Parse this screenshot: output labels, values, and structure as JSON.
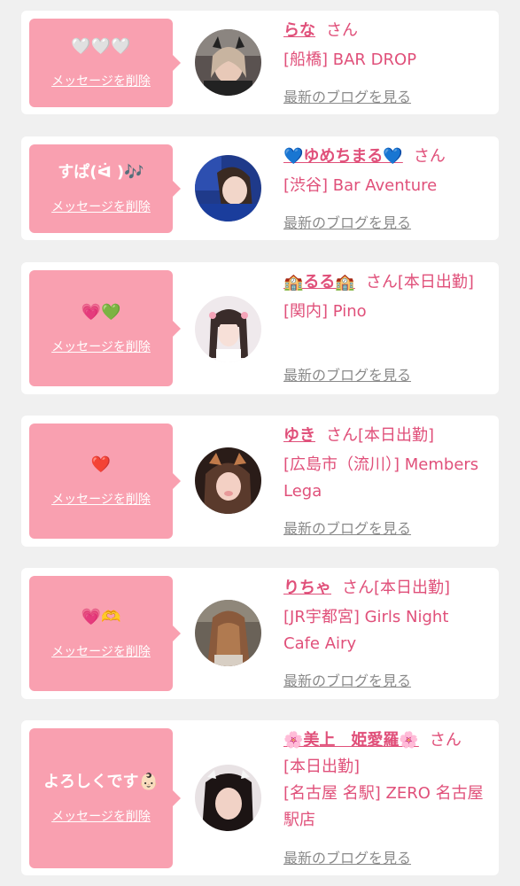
{
  "common": {
    "delete_label": "メッセージを削除",
    "blog_label": "最新のブログを見る"
  },
  "entries": [
    {
      "message": "🤍🤍🤍",
      "name": "らな",
      "san": "さん",
      "shop": "[船橋] BAR DROP",
      "avatar_icon": "profile-photo"
    },
    {
      "message": "すぱ(ᐛ )🎶",
      "name": "💙ゆめちまる💙",
      "san": "さん",
      "shop": "[渋谷] Bar Aventure",
      "avatar_icon": "profile-photo"
    },
    {
      "message": "💗💚",
      "name": "🏫るる🏫",
      "san": "さん[本日出勤]",
      "shop": "[関内] Pino",
      "avatar_icon": "profile-photo"
    },
    {
      "message": "❤️",
      "name": "ゆき",
      "san": "さん[本日出勤]",
      "shop": "[広島市（流川）] Members Lega",
      "avatar_icon": "profile-photo"
    },
    {
      "message": "💗🫶",
      "name": "りちゃ",
      "san": "さん[本日出勤]",
      "shop": "[JR宇都宮] Girls Night Cafe Airy",
      "avatar_icon": "profile-photo"
    },
    {
      "message": "よろしくです👶🏻",
      "name": "🌸美上　姫愛羅🌸",
      "san": "さん",
      "status": "[本日出勤]",
      "shop": "[名古屋 名駅] ZERO 名古屋駅店",
      "avatar_icon": "profile-photo"
    }
  ],
  "colors": {
    "accent": "#e0507a",
    "message_bg": "#f9a0b0",
    "link_gray": "#8a8a8a",
    "page_bg": "#f0f0f0"
  }
}
